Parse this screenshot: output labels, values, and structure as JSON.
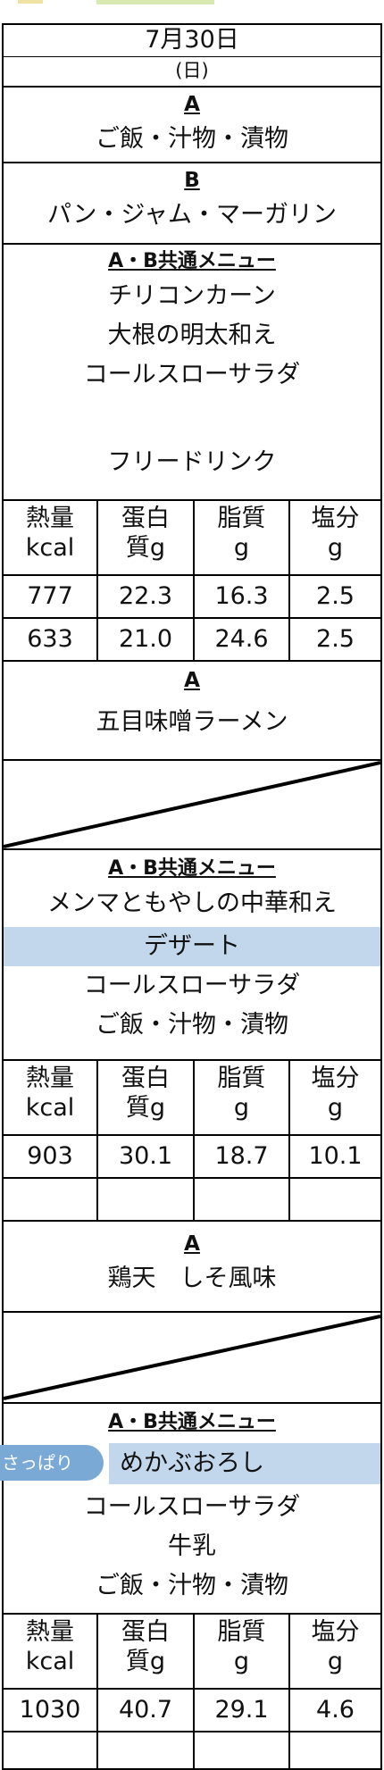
{
  "date": "7月30日",
  "weekday": "(日)",
  "nutrition_headers": {
    "h1": [
      "熱量",
      "kcal"
    ],
    "h2": [
      "蛋白",
      "質g"
    ],
    "h3": [
      "脂質",
      "g"
    ],
    "h4": [
      "塩分",
      "g"
    ]
  },
  "meal1": {
    "a_label": "A",
    "a_item": "ご飯・汁物・漬物",
    "b_label": "B",
    "b_item": "パン・ジャム・マーガリン",
    "common_label": "A・B共通メニュー",
    "common_items": [
      "チリコンカーン",
      "大根の明太和え",
      "コールスローサラダ"
    ],
    "extra": "フリードリンク",
    "values_a": [
      "777",
      "22.3",
      "16.3",
      "2.5"
    ],
    "values_b": [
      "633",
      "21.0",
      "24.6",
      "2.5"
    ]
  },
  "meal2": {
    "a_label": "A",
    "a_item": "五目味噌ラーメン",
    "common_label": "A・B共通メニュー",
    "common_items": [
      "メンマともやしの中華和え",
      "デザート",
      "コールスローサラダ",
      "ご飯・汁物・漬物"
    ],
    "values_a": [
      "903",
      "30.1",
      "18.7",
      "10.1"
    ]
  },
  "meal3": {
    "a_label": "A",
    "a_item": "鶏天　しそ風味",
    "common_label": "A・B共通メニュー",
    "badge": "さっぱり",
    "common_items": [
      "めかぶおろし",
      "コールスローサラダ",
      "牛乳",
      "ご飯・汁物・漬物"
    ],
    "values_a": [
      "1030",
      "40.7",
      "29.1",
      "4.6"
    ]
  },
  "colors": {
    "highlight": "#c2d6ec",
    "badge": "#7aa9d6"
  }
}
